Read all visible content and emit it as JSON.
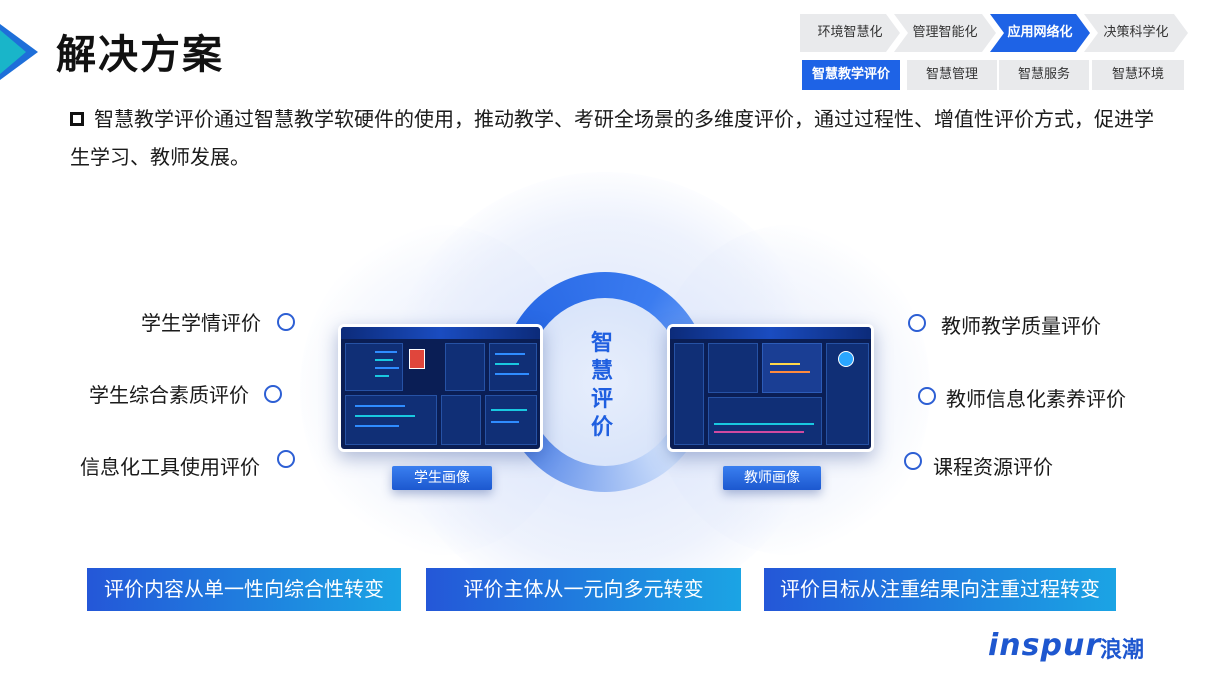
{
  "header": {
    "title": "解决方案"
  },
  "stages": [
    {
      "label": "环境智慧化",
      "active": false
    },
    {
      "label": "管理智能化",
      "active": false
    },
    {
      "label": "应用网络化",
      "active": true
    },
    {
      "label": "决策科学化",
      "active": false
    }
  ],
  "subtabs": [
    {
      "label": "智慧教学评价",
      "active": true
    },
    {
      "label": "智慧管理",
      "active": false
    },
    {
      "label": "智慧服务",
      "active": false
    },
    {
      "label": "智慧环境",
      "active": false
    }
  ],
  "intro": {
    "text": "智慧教学评价通过智慧教学软硬件的使用，推动教学、考研全场景的多维度评价，通过过程性、增值性评价方式，促进学生学习、教师发展。"
  },
  "center": {
    "title": "智慧评价"
  },
  "left_items": [
    "学生学情评价",
    "学生综合素质评价",
    "信息化工具使用评价"
  ],
  "right_items": [
    "教师教学质量评价",
    "教师信息化素养评价",
    "课程资源评价"
  ],
  "portraits": {
    "student": "学生画像",
    "teacher": "教师画像"
  },
  "bottom": [
    "评价内容从单一性向综合性转变",
    "评价主体从一元向多元转变",
    "评价目标从注重结果向注重过程转变"
  ],
  "logo": {
    "brand": "inspur",
    "cn": "浪潮"
  },
  "colors": {
    "primary": "#1e63e6",
    "accent": "#19b5c9"
  }
}
